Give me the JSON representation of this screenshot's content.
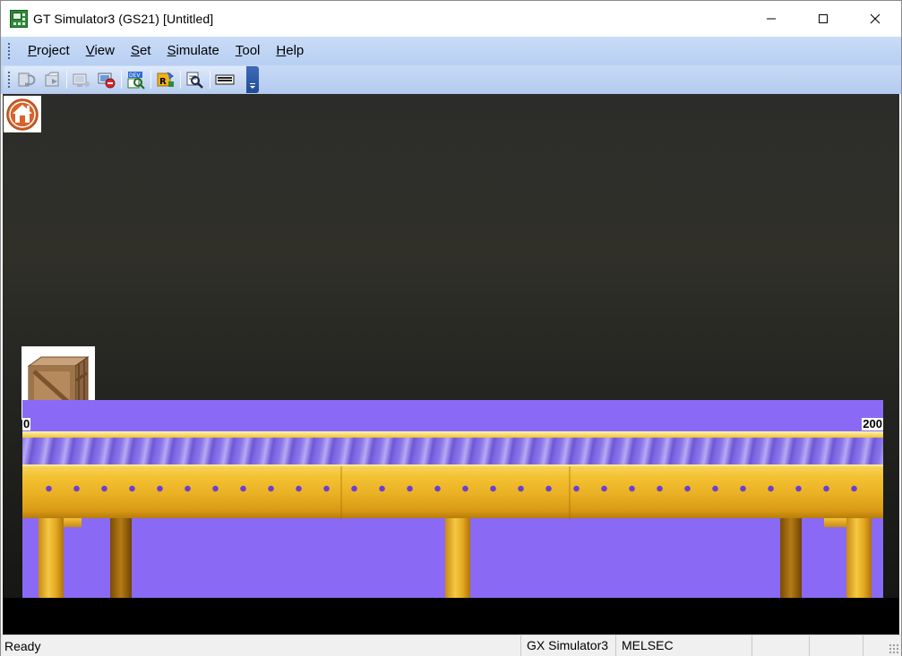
{
  "window": {
    "title": "GT Simulator3 (GS21)  [Untitled]",
    "controls": [
      "minimize-icon",
      "maximize-icon",
      "close-icon"
    ]
  },
  "menu": {
    "items": [
      {
        "prefix": "",
        "underline": "P",
        "rest": "roject"
      },
      {
        "prefix": "",
        "underline": "V",
        "rest": "iew"
      },
      {
        "prefix": "",
        "underline": "S",
        "rest": "et"
      },
      {
        "prefix": "",
        "underline": "S",
        "rest": "imulate"
      },
      {
        "prefix": "",
        "underline": "T",
        "rest": "ool"
      },
      {
        "prefix": "",
        "underline": "H",
        "rest": "elp"
      }
    ]
  },
  "toolbar": {
    "icons": [
      "read-icon",
      "write-icon",
      "start-icon",
      "stop-icon",
      "device-monitor-icon",
      "script-icon",
      "search-icon",
      "keyboard-icon"
    ]
  },
  "screen": {
    "home_icon": "home-icon",
    "box_icon": "wooden-crate-icon",
    "scale_min": "0",
    "scale_max": "200",
    "conveyor_color": "#8a6af5",
    "frame_color": "#f3c232"
  },
  "status": {
    "ready": "Ready",
    "target": "GX Simulator3",
    "connection": "MELSEC"
  }
}
